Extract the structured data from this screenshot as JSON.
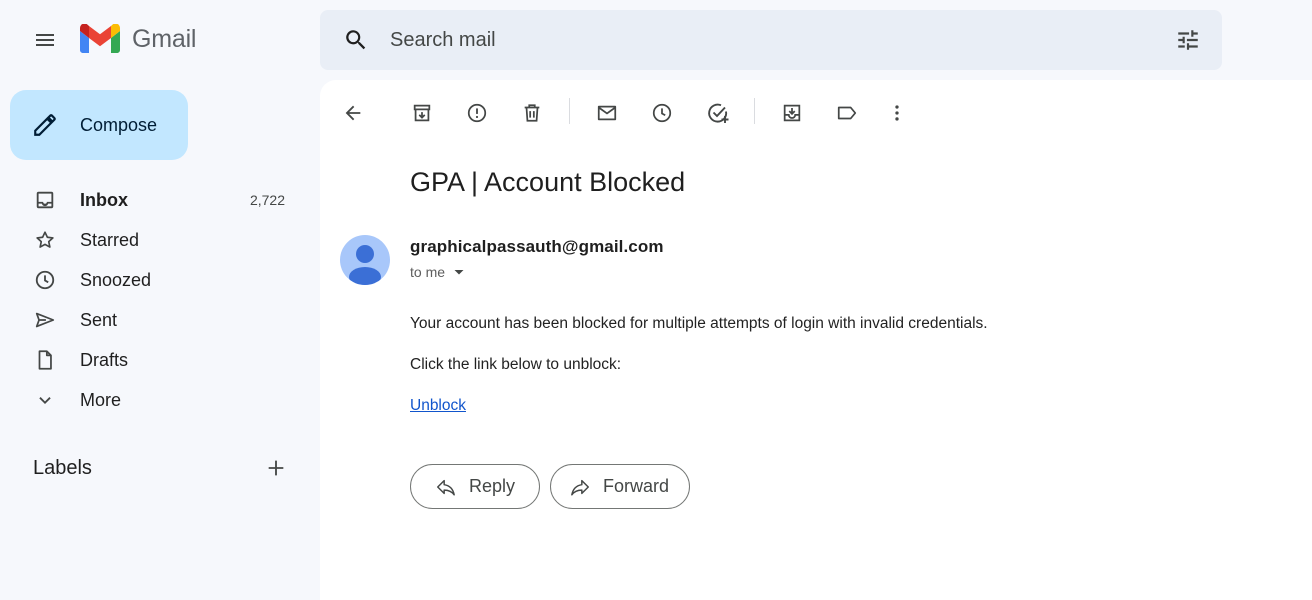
{
  "app": {
    "name": "Gmail"
  },
  "search": {
    "placeholder": "Search mail"
  },
  "compose": {
    "label": "Compose"
  },
  "sidebar": {
    "items": [
      {
        "label": "Inbox",
        "count": "2,722",
        "icon": "inbox-icon",
        "active": true
      },
      {
        "label": "Starred",
        "icon": "star-icon"
      },
      {
        "label": "Snoozed",
        "icon": "clock-icon"
      },
      {
        "label": "Sent",
        "icon": "send-icon"
      },
      {
        "label": "Drafts",
        "icon": "draft-icon"
      },
      {
        "label": "More",
        "icon": "chevron-down-icon"
      }
    ],
    "labels_title": "Labels"
  },
  "toolbar": {
    "icons": [
      "back-arrow-icon",
      "archive-icon",
      "report-spam-icon",
      "delete-icon",
      "mark-unread-icon",
      "snooze-icon",
      "add-task-icon",
      "move-to-icon",
      "label-icon",
      "more-vert-icon"
    ]
  },
  "email": {
    "subject": "GPA | Account Blocked",
    "sender": "graphicalpassauth@gmail.com",
    "recipient": "to me",
    "body": [
      "Your account has been blocked for multiple attempts of login with invalid credentials.",
      "Click the link below to unblock:"
    ],
    "link_text": "Unblock"
  },
  "actions": {
    "reply": "Reply",
    "forward": "Forward"
  },
  "colors": {
    "background": "#f6f8fc",
    "compose_bg": "#c2e7ff",
    "search_bg": "#e9eef6",
    "avatar_bg": "#a8c7fa",
    "link": "#1155cc"
  }
}
